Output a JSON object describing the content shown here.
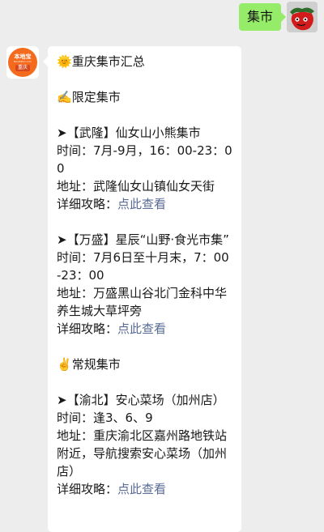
{
  "outgoing": {
    "text": "集市"
  },
  "bot": {
    "logo_top": "本地宝",
    "logo_mid": "BenDiBao.com",
    "logo_city": "重庆"
  },
  "summary": {
    "title_icon": "🌞",
    "title": "重庆集市汇总",
    "limited_icon": "✍️",
    "limited_heading": "限定集市",
    "regular_icon": "✌️",
    "regular_heading": "常规集市",
    "link_text": "点此查看",
    "items": [
      {
        "head": "➤【武隆】仙女山小熊集市",
        "time": "时间：7月-9月，16：00-23：00",
        "addr": "地址：武隆仙女山镇仙女天街",
        "guide": "详细攻略："
      },
      {
        "head": "➤【万盛】星辰“山野·食光市集”",
        "time": "时间：7月6日至十月末，7：00-23：00",
        "addr": "地址：万盛黑山谷北门金科中华养生城大草坪旁",
        "guide": "详细攻略："
      },
      {
        "head": "➤【渝北】安心菜场（加州店）",
        "time": "时间：逢3、6、9",
        "addr": "地址：重庆渝北区嘉州路地铁站附近，导航搜索安心菜场（加州店）",
        "guide": "详细攻略："
      }
    ]
  }
}
